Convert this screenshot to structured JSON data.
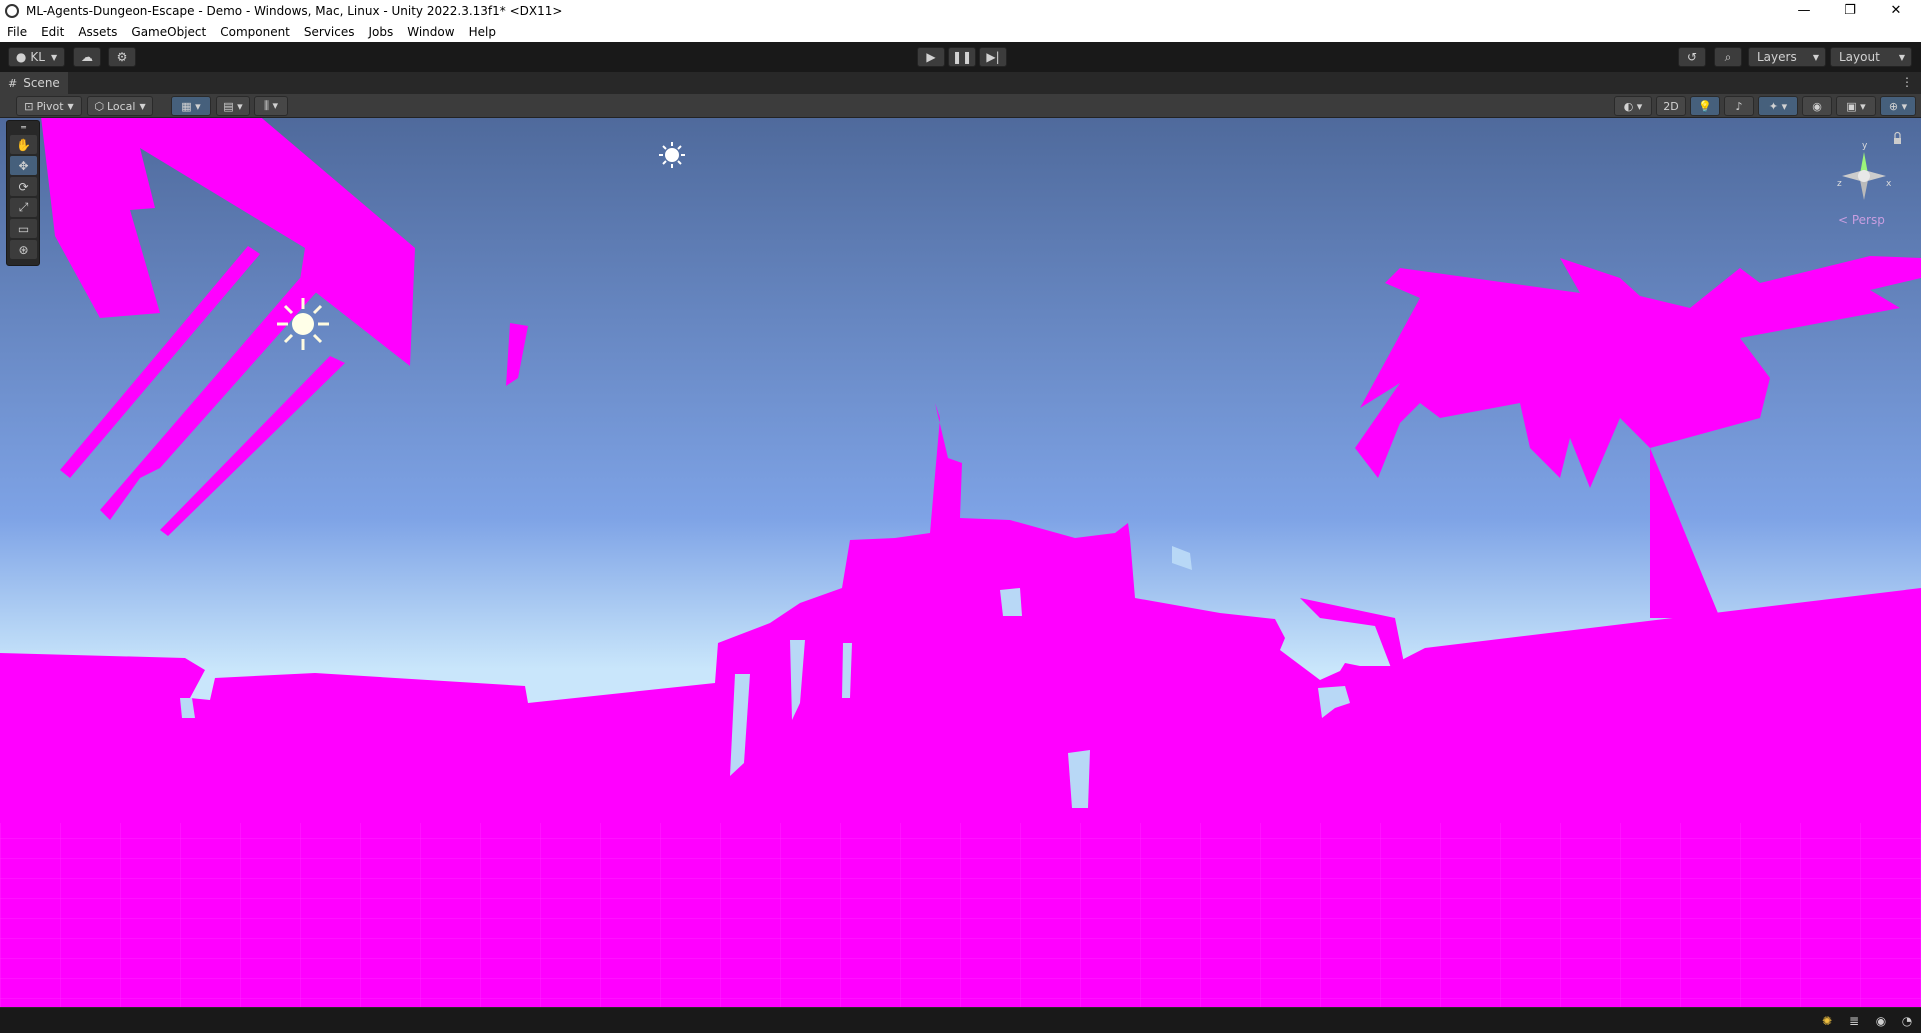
{
  "window": {
    "title": "ML-Agents-Dungeon-Escape - Demo - Windows, Mac, Linux - Unity 2022.3.13f1* <DX11>",
    "minimize": "—",
    "maximize": "❐",
    "close": "✕"
  },
  "menu": [
    "File",
    "Edit",
    "Assets",
    "GameObject",
    "Component",
    "Services",
    "Jobs",
    "Window",
    "Help"
  ],
  "toolbar": {
    "account": "KL",
    "layers": "Layers",
    "layout": "Layout"
  },
  "scene_tab": {
    "label": "Scene"
  },
  "scene_toolbar": {
    "pivot": "Pivot",
    "local": "Local",
    "mode_2d": "2D"
  },
  "gizmo": {
    "projection": "< Persp",
    "axis_y": "y",
    "axis_x": "x",
    "axis_z": "z"
  },
  "colors": {
    "missing_material": "#ff00ff",
    "sky_top": "#4f6a9c",
    "sky_mid": "#7ea3e6",
    "sky_horizon": "#c9e6fb"
  },
  "icons": {
    "tools": [
      "hand-tool-icon",
      "move-tool-icon",
      "rotate-tool-icon",
      "scale-tool-icon",
      "rect-tool-icon",
      "transform-tool-icon"
    ],
    "status": [
      "lighting-icon",
      "cache-icon",
      "collab-icon",
      "progress-icon"
    ]
  }
}
